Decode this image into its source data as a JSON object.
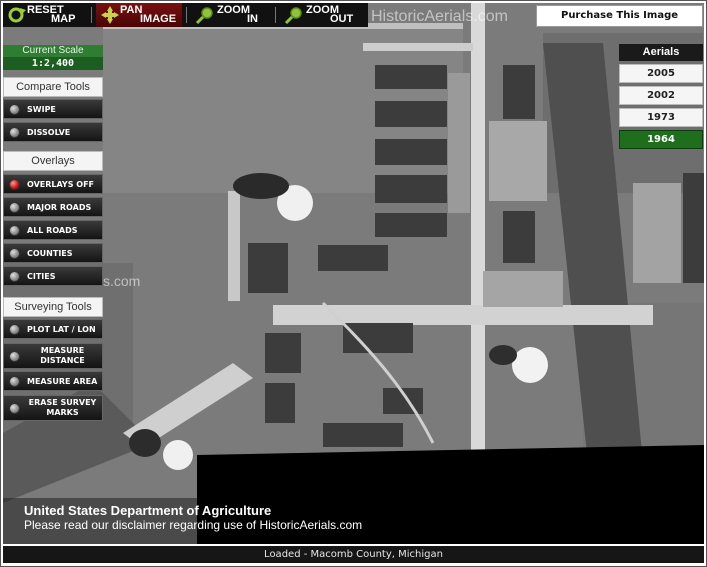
{
  "toolbar": {
    "reset": {
      "line1": "RESET",
      "line2": "MAP"
    },
    "pan": {
      "line1": "PAN",
      "line2": "IMAGE"
    },
    "zoom_in": {
      "line1": "ZOOM",
      "line2": "IN"
    },
    "zoom_out": {
      "line1": "ZOOM",
      "line2": "OUT"
    }
  },
  "watermark": {
    "text": "HistoricAerials.com",
    "fragment": "s.com"
  },
  "scale": {
    "label": "Current Scale",
    "value": "1:2,400"
  },
  "compare_tools": {
    "title": "Compare Tools",
    "items": [
      {
        "label": "SWIPE"
      },
      {
        "label": "DISSOLVE"
      }
    ]
  },
  "overlays": {
    "title": "Overlays",
    "items": [
      {
        "label": "OVERLAYS OFF",
        "active": true
      },
      {
        "label": "MAJOR ROADS"
      },
      {
        "label": "ALL ROADS"
      },
      {
        "label": "COUNTIES"
      },
      {
        "label": "CITIES"
      }
    ]
  },
  "surveying_tools": {
    "title": "Surveying Tools",
    "items": [
      {
        "label": "PLOT LAT / LON"
      },
      {
        "label_line1": "MEASURE",
        "label_line2": "DISTANCE"
      },
      {
        "label": "MEASURE AREA"
      },
      {
        "label_line1": "ERASE SURVEY",
        "label_line2": "MARKS"
      }
    ]
  },
  "purchase": {
    "label": "Purchase This Image"
  },
  "aerials": {
    "title": "Aerials",
    "years": [
      "2005",
      "2002",
      "1973",
      "1964"
    ],
    "selected": "1964"
  },
  "footer": {
    "agency": "United States Department of Agriculture",
    "disclaimer": "Please read our disclaimer regarding use of HistoricAerials.com"
  },
  "status": {
    "text": "Loaded - Macomb County, Michigan"
  },
  "colors": {
    "active_year": "#1e6e1e",
    "scale_green": "#2e7d32",
    "overlay_active": "#d01010"
  }
}
